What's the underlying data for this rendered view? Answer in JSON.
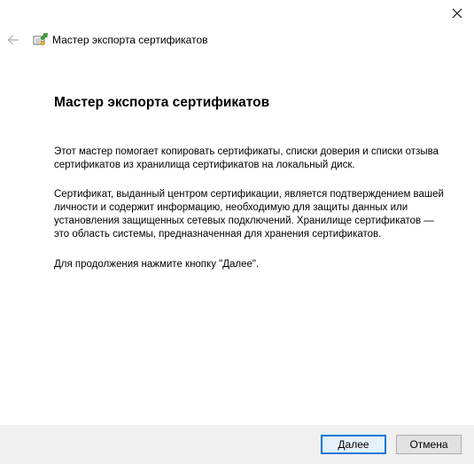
{
  "window": {
    "title": "Мастер экспорта сертификатов"
  },
  "icons": {
    "close": "close-icon",
    "back": "back-arrow-icon",
    "app": "certificate-icon"
  },
  "content": {
    "heading": "Мастер экспорта сертификатов",
    "paragraph1": "Этот мастер помогает копировать сертификаты, списки доверия и списки отзыва сертификатов из хранилища сертификатов на локальный диск.",
    "paragraph2": "Сертификат, выданный центром сертификации, является подтверждением вашей личности и содержит информацию, необходимую для защиты данных или установления защищенных сетевых подключений. Хранилище сертификатов — это область системы, предназначенная для хранения сертификатов.",
    "paragraph3": "Для продолжения нажмите кнопку \"Далее\"."
  },
  "buttons": {
    "next_label": "Далее",
    "cancel_label": "Отмена"
  },
  "colors": {
    "accent": "#0078d7",
    "footer_bg": "#f0f0f0",
    "button_bg": "#e1e1e1"
  }
}
